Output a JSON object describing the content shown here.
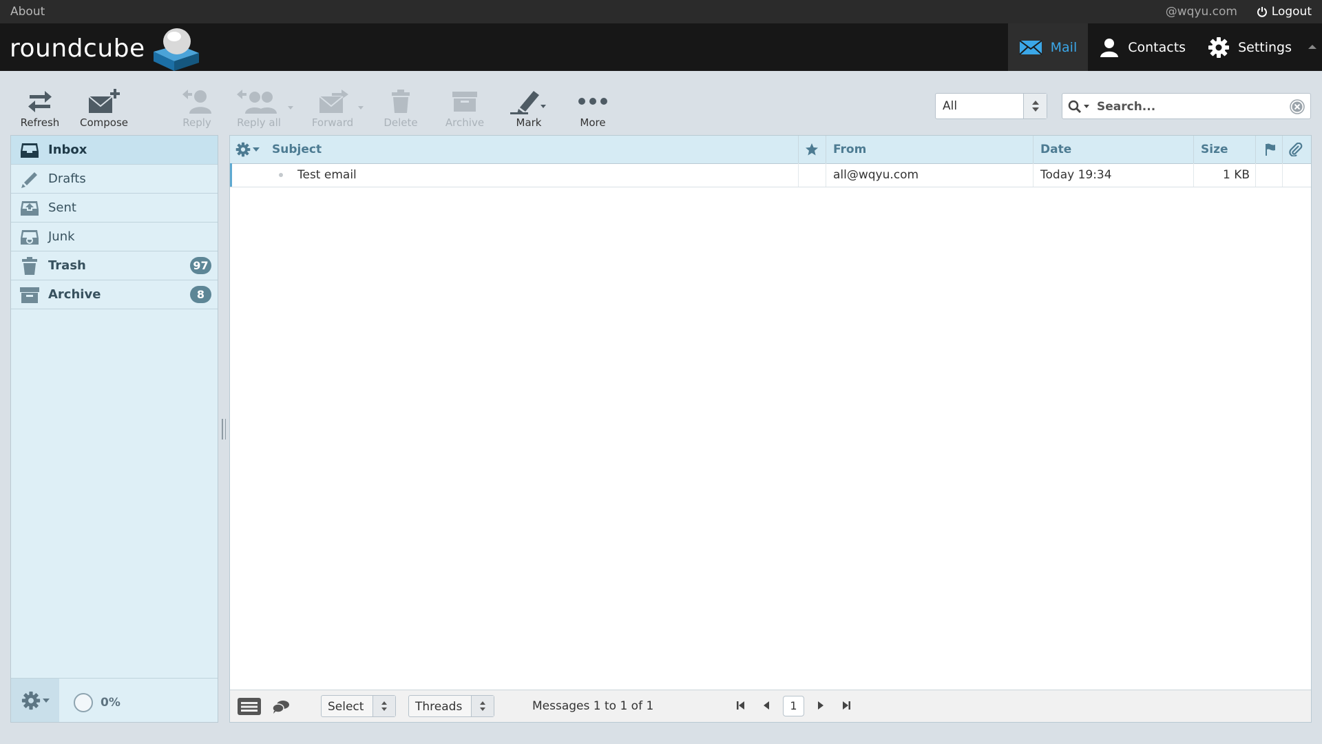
{
  "topline": {
    "about": "About",
    "user": "@wqyu.com",
    "logout": "Logout"
  },
  "header": {
    "logo_text": "roundcube",
    "tasks": {
      "mail": "Mail",
      "contacts": "Contacts",
      "settings": "Settings"
    },
    "accent": "#3ba7e8"
  },
  "toolbar": {
    "refresh": "Refresh",
    "compose": "Compose",
    "reply": "Reply",
    "reply_all": "Reply all",
    "forward": "Forward",
    "delete": "Delete",
    "archive": "Archive",
    "mark": "Mark",
    "more": "More"
  },
  "filter": {
    "value": "All"
  },
  "search": {
    "placeholder": "Search..."
  },
  "folders": {
    "items": [
      {
        "label": "Inbox",
        "icon": "inbox-icon",
        "selected": true
      },
      {
        "label": "Drafts",
        "icon": "pencil-icon"
      },
      {
        "label": "Sent",
        "icon": "sent-icon"
      },
      {
        "label": "Junk",
        "icon": "junk-icon"
      },
      {
        "label": "Trash",
        "icon": "trash-icon",
        "count": "97"
      },
      {
        "label": "Archive",
        "icon": "archive-icon",
        "count": "8"
      }
    ],
    "quota": "0%"
  },
  "list": {
    "columns": {
      "subject": "Subject",
      "from": "From",
      "date": "Date",
      "size": "Size"
    },
    "rows": [
      {
        "subject": "Test email",
        "from": "all@wqyu.com",
        "date": "Today 19:34",
        "size": "1 KB"
      }
    ]
  },
  "listfooter": {
    "select": "Select",
    "threads": "Threads",
    "count_text": "Messages 1 to 1 of 1",
    "page": "1"
  }
}
